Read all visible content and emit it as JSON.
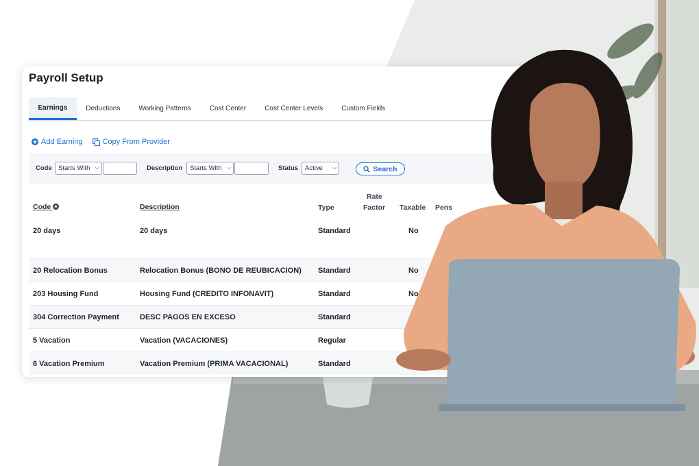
{
  "card": {
    "title": "Payroll Setup"
  },
  "tabs": [
    {
      "label": "Earnings",
      "active": true
    },
    {
      "label": "Deductions",
      "active": false
    },
    {
      "label": "Working Patterns",
      "active": false
    },
    {
      "label": "Cost Center",
      "active": false
    },
    {
      "label": "Cost Center Levels",
      "active": false
    },
    {
      "label": "Custom Fields",
      "active": false
    }
  ],
  "actions": {
    "add_earning": "Add Earning",
    "copy_from_provider": "Copy From Provider"
  },
  "filters": {
    "code_label": "Code",
    "code_operator": "Starts With",
    "code_value": "",
    "description_label": "Description",
    "description_operator": "Starts With",
    "description_value": "",
    "status_label": "Status",
    "status_value": "Active",
    "search_label": "Search"
  },
  "table": {
    "headers": {
      "code": "Code",
      "description": "Description",
      "type": "Type",
      "rate_factor_1": "Rate",
      "rate_factor_2": "Factor",
      "taxable": "Taxable",
      "pension": "Pens"
    },
    "rows": [
      {
        "code": "20 days",
        "description": "20 days",
        "type": "Standard",
        "taxable": "No"
      },
      {
        "code": "20 Relocation Bonus",
        "description": "Relocation Bonus (BONO DE REUBICACION)",
        "type": "Standard",
        "taxable": "No"
      },
      {
        "code": "203 Housing Fund",
        "description": "Housing Fund (CREDITO INFONAVIT)",
        "type": "Standard",
        "taxable": "No"
      },
      {
        "code": "304 Correction Payment",
        "description": "DESC PAGOS EN EXCESO",
        "type": "Standard",
        "taxable": ""
      },
      {
        "code": "5 Vacation",
        "description": "Vacation (VACACIONES)",
        "type": "Regular",
        "taxable": ""
      },
      {
        "code": "6 Vacation Premium",
        "description": "Vacation Premium (PRIMA VACACIONAL)",
        "type": "Standard",
        "taxable": ""
      }
    ]
  },
  "colors": {
    "accent": "#1f6fd1",
    "tab_active_bg": "#eef2f7",
    "filter_bg": "#f4f6f9"
  }
}
